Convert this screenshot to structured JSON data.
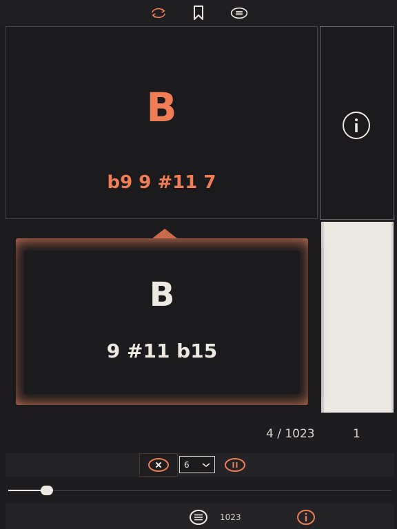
{
  "toolbar": {
    "icons": [
      "refresh-icon",
      "bookmark-icon",
      "menu-icon"
    ]
  },
  "current_chord": {
    "root": "B",
    "extensions": "b9 9 #11 7"
  },
  "next_chord": {
    "root": "B",
    "extensions": "9 #11 b15"
  },
  "counter": {
    "position": "4 / 1023",
    "value": "1"
  },
  "controls": {
    "select_value": "6",
    "slider_fraction": 0.1
  },
  "bottom": {
    "count": "1023"
  },
  "colors": {
    "accent": "#ef7d56",
    "background": "#1d1c1e",
    "light": "#ece8e2"
  }
}
